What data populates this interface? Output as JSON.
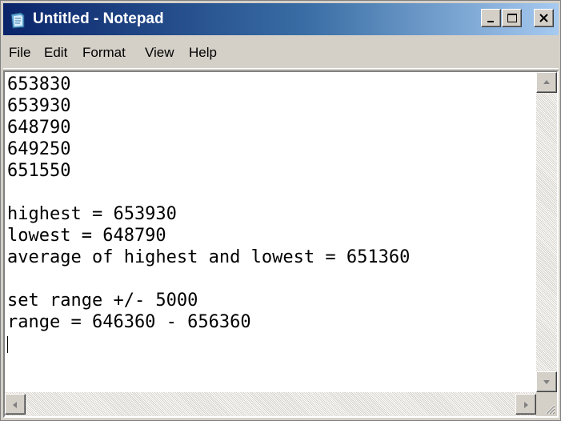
{
  "window": {
    "title": "Untitled - Notepad",
    "icon": "notepad-icon",
    "controls": {
      "minimize": "minimize-icon",
      "maximize": "maximize-icon",
      "close": "close-icon"
    }
  },
  "menu": {
    "items": [
      {
        "label": "File"
      },
      {
        "label": "Edit"
      },
      {
        "label": "Format"
      },
      {
        "label": "View"
      },
      {
        "label": "Help"
      }
    ]
  },
  "editor": {
    "lines": [
      "653830",
      "653930",
      "648790",
      "649250",
      "651550",
      "",
      "highest = 653930",
      "lowest = 648790",
      "average of highest and lowest = 651360",
      "",
      "set range +/- 5000",
      "range = 646360 - 656360"
    ]
  },
  "colors": {
    "title_start": "#0a246a",
    "title_end": "#a6caf0",
    "chrome": "#d4d0c8",
    "editor_bg": "#ffffff"
  }
}
